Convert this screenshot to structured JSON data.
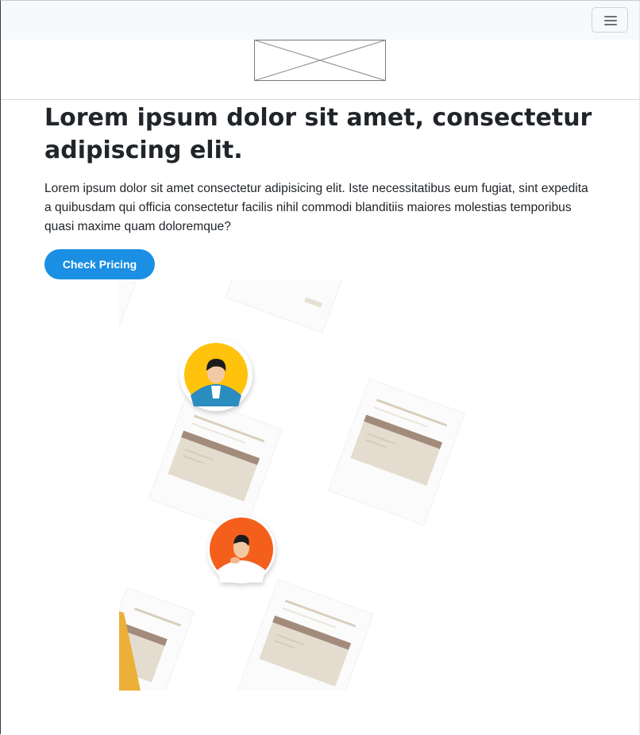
{
  "navbar": {
    "toggler_icon": "hamburger-menu-icon",
    "logo_icon": "logo-placeholder-icon"
  },
  "hero": {
    "title": "Lorem ipsum dolor sit amet, consectetur adipiscing elit.",
    "text": "Lorem ipsum dolor sit amet consectetur adipisicing elit. Iste necessitatibus eum fugiat, sint expedita a quibusdam qui officia consectetur facilis nihil commodi blanditiis maiores molestias temporibus quasi maxime quam doloremque?",
    "cta_label": "Check Pricing"
  },
  "colors": {
    "primary": "#1a8fe3",
    "navbar_bg": "#f8f9fa",
    "avatar_yellow": "#ffc20e",
    "avatar_orange": "#f4601f"
  }
}
